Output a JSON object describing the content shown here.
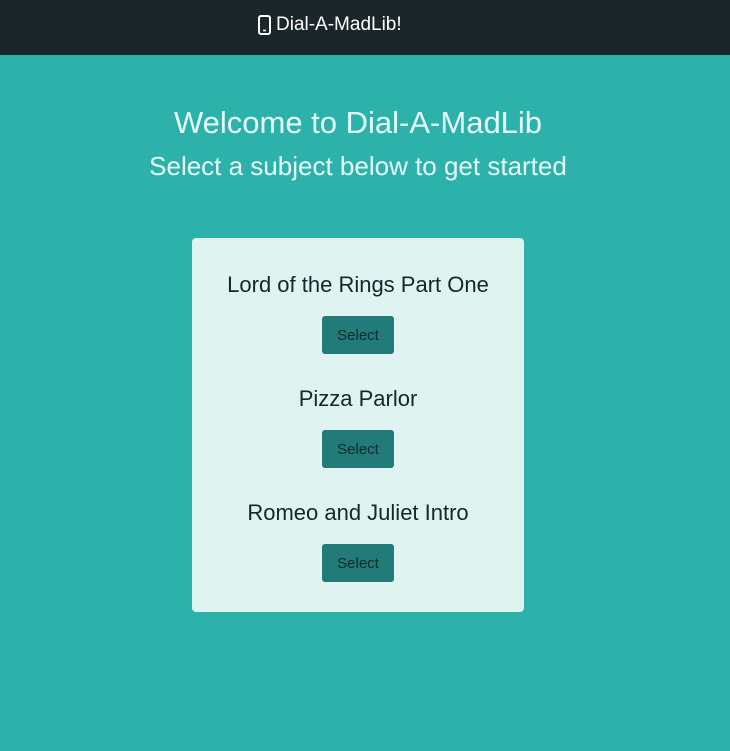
{
  "navbar": {
    "brand": "Dial-A-MadLib!",
    "brand_icon": "mobile-phone-icon"
  },
  "hero": {
    "title": "Welcome to Dial-A-MadLib",
    "subtitle": "Select a subject below to get started"
  },
  "subjects": [
    {
      "title": "Lord of the Rings Part One",
      "button": "Select"
    },
    {
      "title": "Pizza Parlor",
      "button": "Select"
    },
    {
      "title": "Romeo and Juliet Intro",
      "button": "Select"
    }
  ],
  "colors": {
    "background": "#2db1ab",
    "navbar": "#1b262b",
    "card": "#dff3f1",
    "button": "#227b78"
  }
}
